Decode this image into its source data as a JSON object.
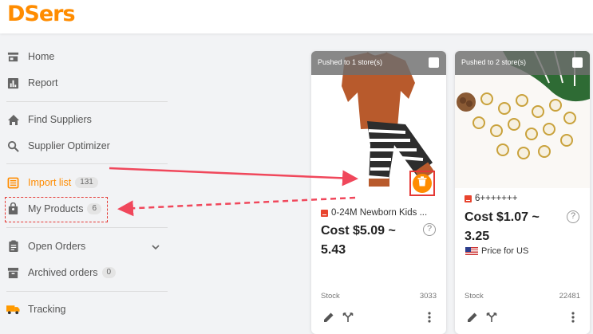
{
  "app": {
    "logo": "DSers"
  },
  "sidebar": {
    "items": [
      {
        "label": "Home",
        "icon": "store-icon"
      },
      {
        "label": "Report",
        "icon": "report-chart-icon"
      },
      {
        "label": "Find Suppliers",
        "icon": "home-icon"
      },
      {
        "label": "Supplier Optimizer",
        "icon": "search-icon"
      },
      {
        "label": "Import list",
        "icon": "list-icon",
        "badge": "131",
        "active": true
      },
      {
        "label": "My Products",
        "icon": "bag-icon",
        "badge": "6"
      },
      {
        "label": "Open Orders",
        "icon": "clipboard-icon"
      },
      {
        "label": "Archived orders",
        "icon": "archive-icon",
        "badge": "0"
      },
      {
        "label": "Tracking",
        "icon": "truck-icon"
      }
    ]
  },
  "cards": [
    {
      "pushed_text": "Pushed to  1 store(s)",
      "title": "0-24M Newborn Kids ...",
      "cost_line1": "Cost $5.09 ~",
      "cost_line2": "5.43",
      "stock_label": "Stock",
      "stock_value": "3033"
    },
    {
      "pushed_text": "Pushed to  2 store(s)",
      "title": "6+++++++",
      "cost_line1": "Cost $1.07 ~",
      "cost_line2": "3.25",
      "price_note": "Price for US",
      "stock_label": "Stock",
      "stock_value": "22481"
    }
  ],
  "colors": {
    "accent": "#ff8c00",
    "annotation": "#f0475b"
  }
}
